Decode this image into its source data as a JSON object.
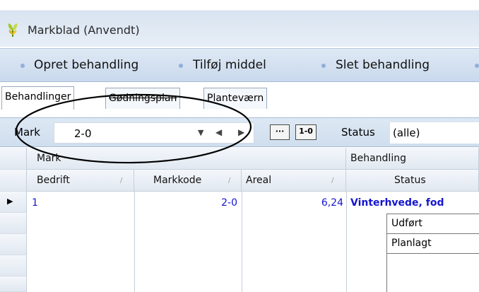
{
  "window": {
    "title": "Markblad (Anvendt)",
    "app_icon": "leaf-icon"
  },
  "toolbar": {
    "items": [
      {
        "label": "Opret behandling"
      },
      {
        "label": "Tilføj middel"
      },
      {
        "label": "Slet behandling"
      }
    ]
  },
  "tabs": [
    {
      "label": "Behandlinger",
      "active": true
    },
    {
      "label": "Gødningsplan",
      "active": false
    },
    {
      "label": "Planteværn",
      "active": false
    }
  ],
  "filter": {
    "mark_label": "Mark",
    "mark_value": "2-0",
    "ellipsis_label": "···",
    "range_label": "1-0",
    "status_label": "Status",
    "status_value": "(alle)"
  },
  "grid": {
    "group_headers": {
      "mark": "Mark",
      "behandling": "Behandling"
    },
    "columns": {
      "bedrift": "Bedrift",
      "markkode": "Markkode",
      "areal": "Areal",
      "status": "Status"
    },
    "sort_glyph": "/",
    "rows": [
      {
        "bedrift": "1",
        "markkode": "2-0",
        "areal": "6,24",
        "behandling": "Vinterhvede, fod"
      }
    ],
    "sub_rows": [
      {
        "status": "Udført"
      },
      {
        "status": "Planlagt"
      }
    ]
  },
  "colors": {
    "link_blue": "#1515d0",
    "toolbar_bg": "#d3e1f1",
    "annotation": "#000000"
  }
}
